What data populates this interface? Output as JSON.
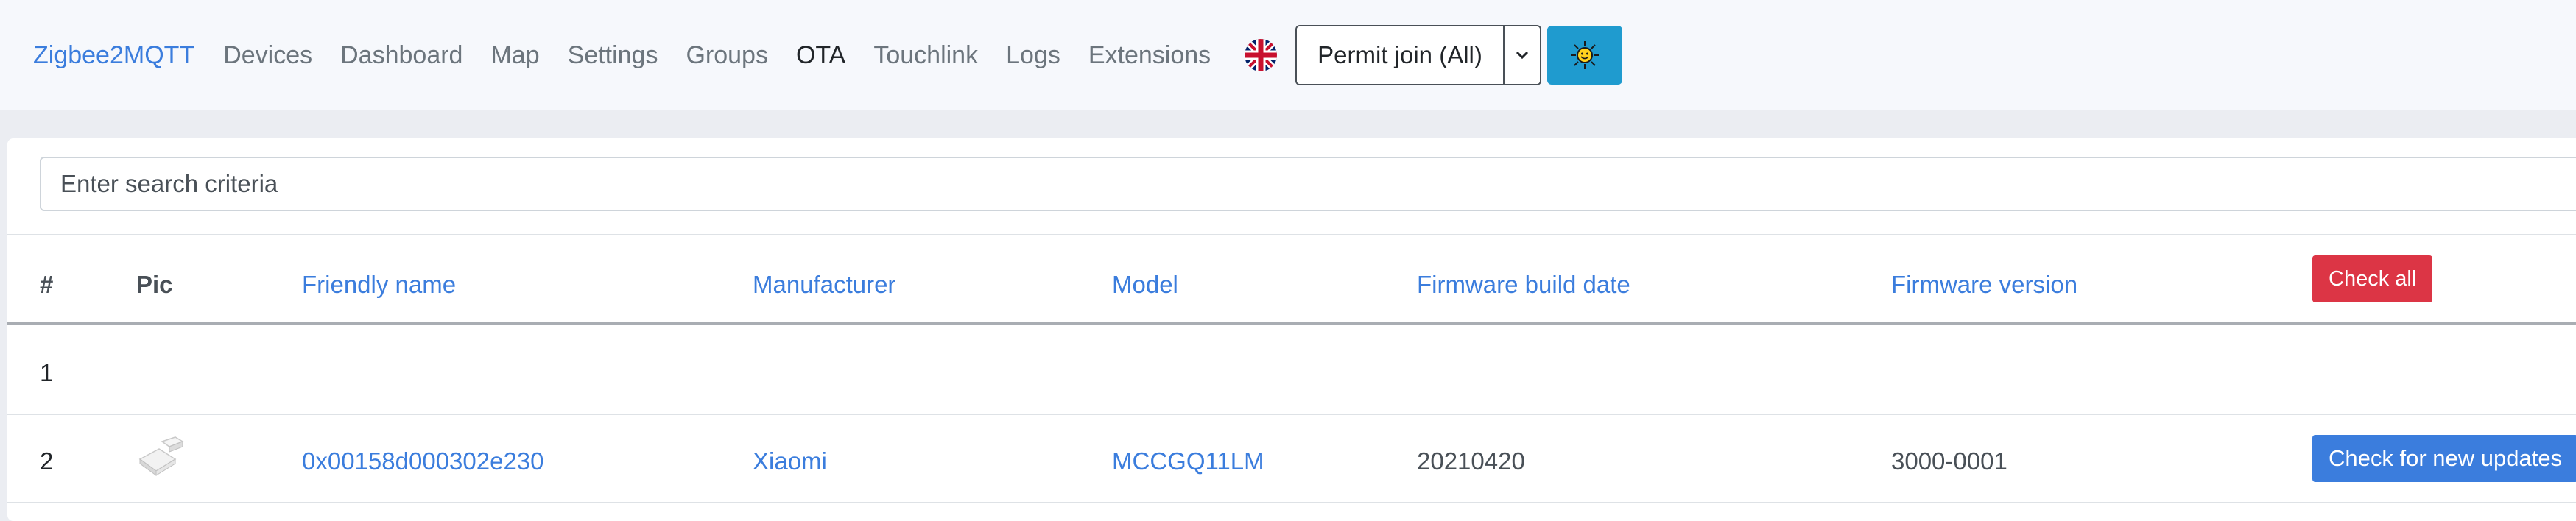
{
  "nav": {
    "brand": "Zigbee2MQTT",
    "items": [
      {
        "label": "Devices"
      },
      {
        "label": "Dashboard"
      },
      {
        "label": "Map"
      },
      {
        "label": "Settings"
      },
      {
        "label": "Groups"
      },
      {
        "label": "OTA",
        "active": true
      },
      {
        "label": "Touchlink"
      },
      {
        "label": "Logs"
      },
      {
        "label": "Extensions"
      }
    ],
    "language_icon": "uk-flag-icon",
    "permit_join_label": "Permit join (All)",
    "permit_caret_icon": "chevron-down-icon",
    "theme_icon": "sun-icon",
    "theme_color": "#1f9bcf"
  },
  "search": {
    "placeholder": "Enter search criteria"
  },
  "table": {
    "headers": {
      "index": "#",
      "pic": "Pic",
      "friendly_name": "Friendly name",
      "manufacturer": "Manufacturer",
      "model": "Model",
      "firmware_build_date": "Firmware build date",
      "firmware_version": "Firmware version",
      "check_all": "Check all"
    },
    "rows": [
      {
        "index": "1",
        "friendly_name": "",
        "manufacturer": "",
        "model": "",
        "firmware_build_date": "",
        "firmware_version": "",
        "action": ""
      },
      {
        "index": "2",
        "pic_icon": "door-sensor-icon",
        "friendly_name": "0x00158d000302e230",
        "manufacturer": "Xiaomi",
        "model": "MCCGQ11LM",
        "firmware_build_date": "20210420",
        "firmware_version": "3000-0001",
        "action": "Check for new updates"
      }
    ]
  },
  "colors": {
    "accent": "#3b7ddd",
    "danger": "#dc3545"
  }
}
